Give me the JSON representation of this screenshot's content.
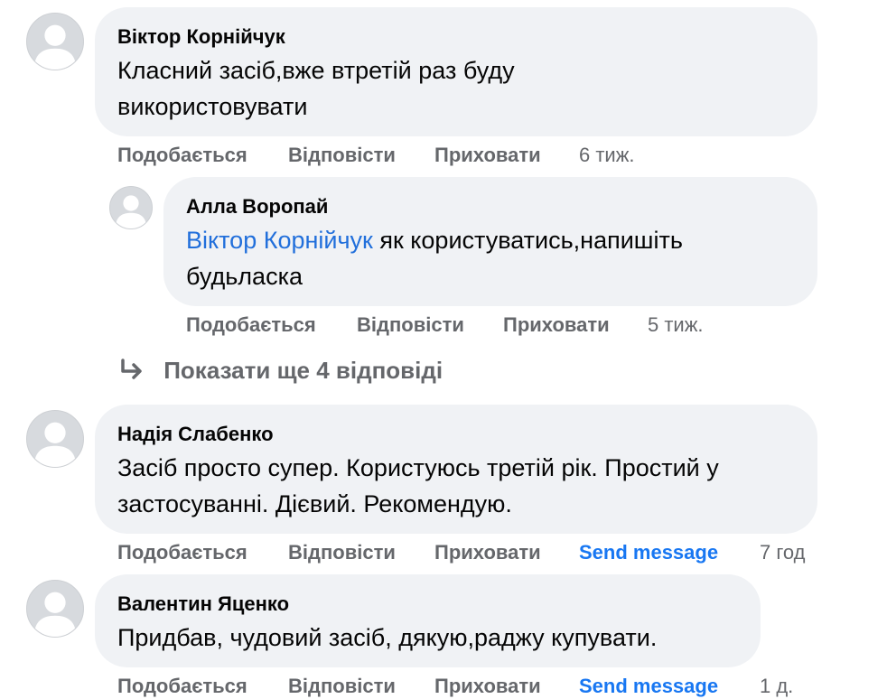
{
  "comments": [
    {
      "author": "Віктор Корнійчук",
      "text": "Класний засіб,вже втретій раз буду використовувати",
      "like": "Подобається",
      "reply": "Відповісти",
      "hide": "Приховати",
      "time": "6 тиж."
    },
    {
      "author": "Алла Воропай",
      "mention": "Віктор Корнійчук",
      "text": " як користуватись,напишіть будьласка",
      "like": "Подобається",
      "reply": "Відповісти",
      "hide": "Приховати",
      "time": "5 тиж."
    },
    {
      "author": "Надія Слабенко",
      "text": "Засіб просто супер. Користуюсь третій рік. Простий у застосуванні. Дієвий. Рекомендую.",
      "like": "Подобається",
      "reply": "Відповісти",
      "hide": "Приховати",
      "send": "Send message",
      "time": "7 год"
    },
    {
      "author": "Валентин Яценко",
      "text": "Придбав, чудовий засіб, дякую,раджу купувати.",
      "like": "Подобається",
      "reply": "Відповісти",
      "hide": "Приховати",
      "send": "Send message",
      "time": "1 д."
    }
  ],
  "more_replies": "Показати ще 4 відповіді",
  "icons": {
    "avatar": "default-profile-silhouette-icon",
    "reply_arrow": "reply-arrow-icon"
  },
  "colors": {
    "bubble": "#f0f2f5",
    "mention": "#216fdb",
    "action": "#65676b",
    "send_message": "#1877f2"
  }
}
